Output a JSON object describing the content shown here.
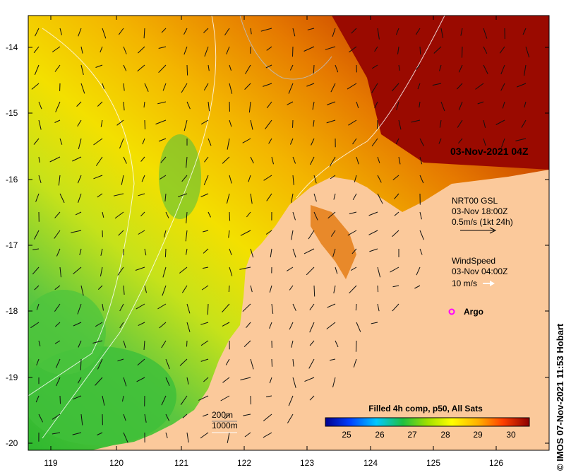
{
  "timestamp": "03-Nov-2021 04Z",
  "axes": {
    "lat_ticks": [
      "-14",
      "-15",
      "-16",
      "-17",
      "-18",
      "-19",
      "-20"
    ],
    "lon_ticks": [
      "119",
      "120",
      "121",
      "122",
      "123",
      "124",
      "125",
      "126"
    ]
  },
  "current_legend": {
    "title": "NRT00 GSL",
    "time": "03-Nov 18:00Z",
    "scale": "0.5m/s (1kt 24h)"
  },
  "wind_legend": {
    "title": "WindSpeed",
    "time": "03-Nov 04:00Z",
    "scale": "10 m/s"
  },
  "argo_label": "Argo",
  "isobath": {
    "shallow": "200m",
    "deep": "1000m"
  },
  "colorbar": {
    "title": "Filled 4h comp, p50, All Sats",
    "ticks": [
      "25",
      "26",
      "27",
      "28",
      "29",
      "30"
    ]
  },
  "credit": "© IMOS 07-Nov-2021 11:53 Hobart",
  "colors": {
    "land": "#fbc99b",
    "sst_hot": "#9a0a00",
    "sst_mid": "#f5a000",
    "sst_cool": "#33c133"
  }
}
